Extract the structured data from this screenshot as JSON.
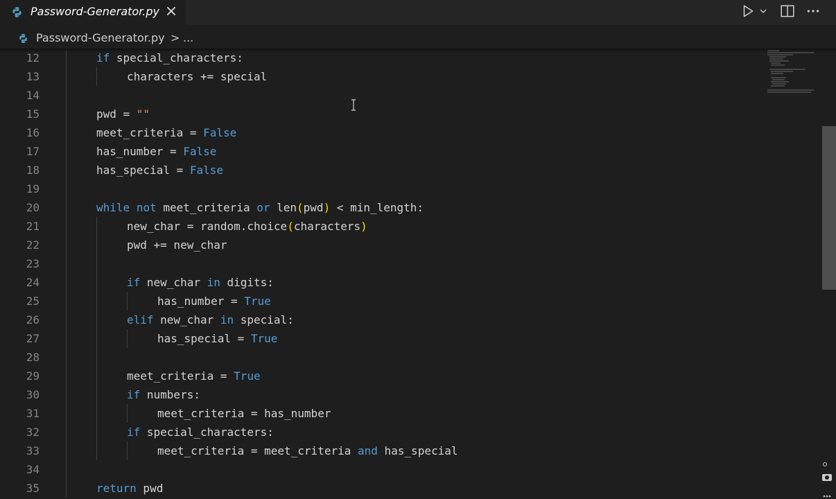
{
  "tab": {
    "title": "Password-Generator.py",
    "file_icon": "python-file-icon",
    "close_icon": "close-icon"
  },
  "actions": {
    "run": "play-icon",
    "run_menu": "chevron-down-icon",
    "split": "split-editor-icon",
    "more": "more-icon"
  },
  "breadcrumb": {
    "file": "Password-Generator.py",
    "separator": ">",
    "more": "..."
  },
  "colors": {
    "background": "#1e1e1e",
    "keyword": "#569cd6",
    "control": "#c586c0",
    "variable": "#9cdcfe",
    "default": "#d4d4d4",
    "string": "#ce9178",
    "function": "#dcdcaa",
    "bracket": "#ffd700",
    "line_number": "#858585"
  },
  "lines": [
    {
      "n": "12",
      "indent": 1,
      "tokens": [
        {
          "t": "if",
          "c": "kw"
        },
        {
          "t": " special_characters:",
          "c": "tx"
        }
      ]
    },
    {
      "n": "13",
      "indent": 2,
      "tokens": [
        {
          "t": "characters += special",
          "c": "tx"
        }
      ]
    },
    {
      "n": "14",
      "indent": 0,
      "tokens": []
    },
    {
      "n": "15",
      "indent": 1,
      "tokens": [
        {
          "t": "pwd = ",
          "c": "tx"
        },
        {
          "t": "\"\"",
          "c": "str"
        }
      ]
    },
    {
      "n": "16",
      "indent": 1,
      "tokens": [
        {
          "t": "meet_criteria = ",
          "c": "tx"
        },
        {
          "t": "False",
          "c": "kw"
        }
      ]
    },
    {
      "n": "17",
      "indent": 1,
      "tokens": [
        {
          "t": "has_number = ",
          "c": "tx"
        },
        {
          "t": "False",
          "c": "kw"
        }
      ]
    },
    {
      "n": "18",
      "indent": 1,
      "tokens": [
        {
          "t": "has_special = ",
          "c": "tx"
        },
        {
          "t": "False",
          "c": "kw"
        }
      ]
    },
    {
      "n": "19",
      "indent": 0,
      "tokens": []
    },
    {
      "n": "20",
      "indent": 1,
      "tokens": [
        {
          "t": "while",
          "c": "kw"
        },
        {
          "t": " ",
          "c": "tx"
        },
        {
          "t": "not",
          "c": "kw"
        },
        {
          "t": " meet_criteria ",
          "c": "tx"
        },
        {
          "t": "or",
          "c": "kw"
        },
        {
          "t": " len",
          "c": "tx"
        },
        {
          "t": "(",
          "c": "br"
        },
        {
          "t": "pwd",
          "c": "tx"
        },
        {
          "t": ")",
          "c": "br"
        },
        {
          "t": " < min_length:",
          "c": "tx"
        }
      ]
    },
    {
      "n": "21",
      "indent": 2,
      "tokens": [
        {
          "t": "new_char = random.choice",
          "c": "tx"
        },
        {
          "t": "(",
          "c": "br"
        },
        {
          "t": "characters",
          "c": "tx"
        },
        {
          "t": ")",
          "c": "br"
        }
      ]
    },
    {
      "n": "22",
      "indent": 2,
      "tokens": [
        {
          "t": "pwd += new_char",
          "c": "tx"
        }
      ]
    },
    {
      "n": "23",
      "indent": 0,
      "tokens": []
    },
    {
      "n": "24",
      "indent": 2,
      "tokens": [
        {
          "t": "if",
          "c": "kw"
        },
        {
          "t": " new_char ",
          "c": "tx"
        },
        {
          "t": "in",
          "c": "kw"
        },
        {
          "t": " digits:",
          "c": "tx"
        }
      ]
    },
    {
      "n": "25",
      "indent": 3,
      "tokens": [
        {
          "t": "has_number = ",
          "c": "tx"
        },
        {
          "t": "True",
          "c": "kw"
        }
      ]
    },
    {
      "n": "26",
      "indent": 2,
      "tokens": [
        {
          "t": "elif",
          "c": "kw"
        },
        {
          "t": " new_char ",
          "c": "tx"
        },
        {
          "t": "in",
          "c": "kw"
        },
        {
          "t": " special:",
          "c": "tx"
        }
      ]
    },
    {
      "n": "27",
      "indent": 3,
      "tokens": [
        {
          "t": "has_special = ",
          "c": "tx"
        },
        {
          "t": "True",
          "c": "kw"
        }
      ]
    },
    {
      "n": "28",
      "indent": 0,
      "tokens": []
    },
    {
      "n": "29",
      "indent": 2,
      "tokens": [
        {
          "t": "meet_criteria = ",
          "c": "tx"
        },
        {
          "t": "True",
          "c": "kw"
        }
      ]
    },
    {
      "n": "30",
      "indent": 2,
      "tokens": [
        {
          "t": "if",
          "c": "kw"
        },
        {
          "t": " numbers:",
          "c": "tx"
        }
      ]
    },
    {
      "n": "31",
      "indent": 3,
      "tokens": [
        {
          "t": "meet_criteria = has_number",
          "c": "tx"
        }
      ]
    },
    {
      "n": "32",
      "indent": 2,
      "tokens": [
        {
          "t": "if",
          "c": "kw"
        },
        {
          "t": " special_characters:",
          "c": "tx"
        }
      ]
    },
    {
      "n": "33",
      "indent": 3,
      "tokens": [
        {
          "t": "meet_criteria = meet_criteria ",
          "c": "tx"
        },
        {
          "t": "and",
          "c": "kw"
        },
        {
          "t": " has_special",
          "c": "tx"
        }
      ]
    },
    {
      "n": "34",
      "indent": 0,
      "tokens": []
    },
    {
      "n": "35",
      "indent": 1,
      "tokens": [
        {
          "t": "return",
          "c": "kw"
        },
        {
          "t": " pwd",
          "c": "tx"
        }
      ]
    }
  ]
}
